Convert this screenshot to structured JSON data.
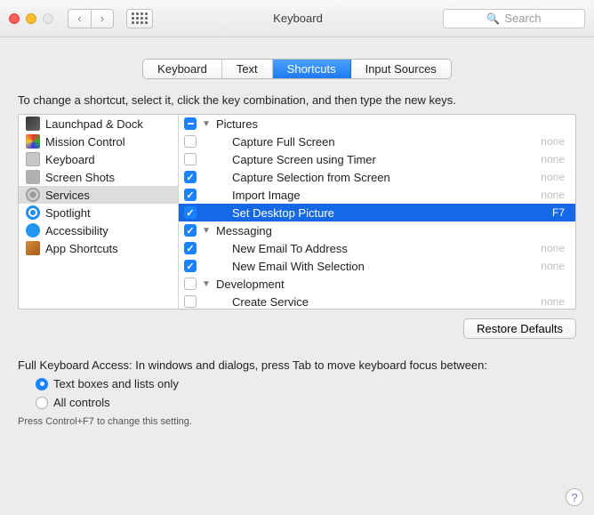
{
  "window": {
    "title": "Keyboard"
  },
  "search": {
    "placeholder": "Search"
  },
  "tabs": [
    {
      "label": "Keyboard",
      "active": false
    },
    {
      "label": "Text",
      "active": false
    },
    {
      "label": "Shortcuts",
      "active": true
    },
    {
      "label": "Input Sources",
      "active": false
    }
  ],
  "instruction": "To change a shortcut, select it, click the key combination, and then type the new keys.",
  "categories": [
    {
      "label": "Launchpad & Dock",
      "icon": "ic-launchpad",
      "selected": false
    },
    {
      "label": "Mission Control",
      "icon": "ic-mission",
      "selected": false
    },
    {
      "label": "Keyboard",
      "icon": "ic-keyboard",
      "selected": false
    },
    {
      "label": "Screen Shots",
      "icon": "ic-screenshot",
      "selected": false
    },
    {
      "label": "Services",
      "icon": "ic-services",
      "selected": true
    },
    {
      "label": "Spotlight",
      "icon": "ic-spotlight",
      "selected": false
    },
    {
      "label": "Accessibility",
      "icon": "ic-accessibility",
      "selected": false
    },
    {
      "label": "App Shortcuts",
      "icon": "ic-appshort",
      "selected": false
    }
  ],
  "items": [
    {
      "label": "Pictures",
      "check": "mixed",
      "group": true,
      "indent": 1,
      "shortcut": "",
      "selected": false,
      "expanded": true
    },
    {
      "label": "Capture Full Screen",
      "check": "off",
      "group": false,
      "indent": 2,
      "shortcut": "none",
      "selected": false
    },
    {
      "label": "Capture Screen using Timer",
      "check": "off",
      "group": false,
      "indent": 2,
      "shortcut": "none",
      "selected": false
    },
    {
      "label": "Capture Selection from Screen",
      "check": "on",
      "group": false,
      "indent": 2,
      "shortcut": "none",
      "selected": false
    },
    {
      "label": "Import Image",
      "check": "on",
      "group": false,
      "indent": 2,
      "shortcut": "none",
      "selected": false
    },
    {
      "label": "Set Desktop Picture",
      "check": "on",
      "group": false,
      "indent": 2,
      "shortcut": "F7",
      "selected": true
    },
    {
      "label": "Messaging",
      "check": "on",
      "group": true,
      "indent": 1,
      "shortcut": "",
      "selected": false,
      "expanded": true
    },
    {
      "label": "New Email To Address",
      "check": "on",
      "group": false,
      "indent": 2,
      "shortcut": "none",
      "selected": false
    },
    {
      "label": "New Email With Selection",
      "check": "on",
      "group": false,
      "indent": 2,
      "shortcut": "none",
      "selected": false
    },
    {
      "label": "Development",
      "check": "off",
      "group": true,
      "indent": 1,
      "shortcut": "",
      "selected": false,
      "expanded": true
    },
    {
      "label": "Create Service",
      "check": "off",
      "group": false,
      "indent": 2,
      "shortcut": "none",
      "selected": false
    }
  ],
  "restore": {
    "label": "Restore Defaults"
  },
  "fka": {
    "text": "Full Keyboard Access: In windows and dialogs, press Tab to move keyboard focus between:",
    "opt1": "Text boxes and lists only",
    "opt2": "All controls",
    "hint": "Press Control+F7 to change this setting."
  },
  "help": {
    "label": "?"
  }
}
